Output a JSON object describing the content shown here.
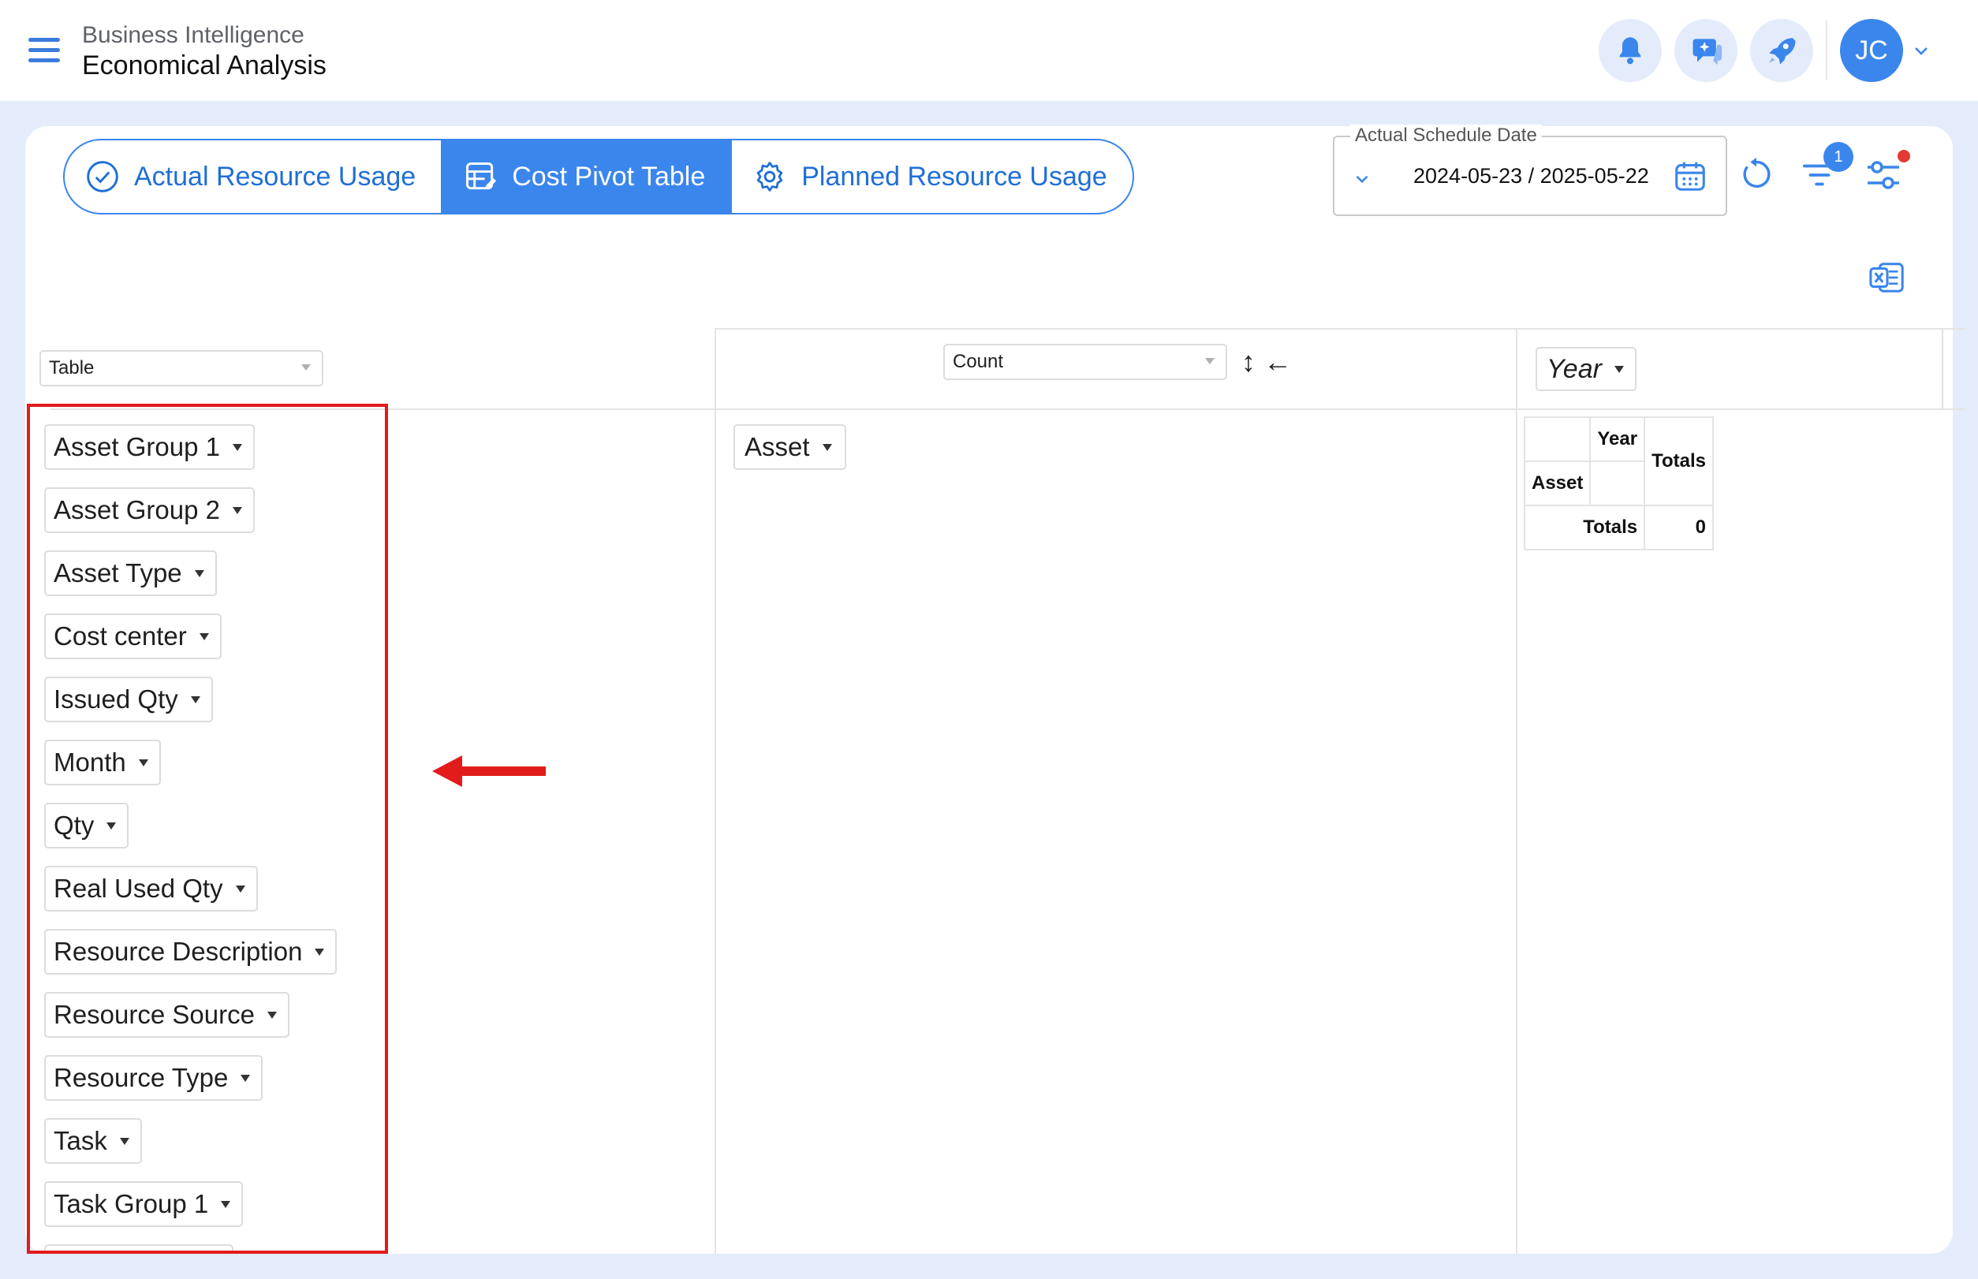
{
  "header": {
    "breadcrumb_parent": "Business Intelligence",
    "page_title": "Economical Analysis",
    "avatar_initials": "JC"
  },
  "tabs": [
    {
      "label": "Actual Resource Usage",
      "icon": "check-circle-icon",
      "active": false
    },
    {
      "label": "Cost Pivot Table",
      "icon": "table-edit-icon",
      "active": true
    },
    {
      "label": "Planned Resource Usage",
      "icon": "gear-icon",
      "active": false
    }
  ],
  "date_filter": {
    "label": "Actual Schedule Date",
    "value": "2024-05-23 / 2025-05-22"
  },
  "filter_badge_count": "1",
  "pivot": {
    "renderer_select": "Table",
    "aggregator_select": "Count",
    "sort_arrows": "↕ ←",
    "unused_fields": [
      "Asset Group 1",
      "Asset Group 2",
      "Asset Type",
      "Cost center",
      "Issued Qty",
      "Month",
      "Qty",
      "Real Used Qty",
      "Resource Description",
      "Resource Source",
      "Resource Type",
      "Task",
      "Task Group 1"
    ],
    "column_field": "Year",
    "row_field": "Asset",
    "table": {
      "col_header": "Year",
      "row_header": "Asset",
      "totals_header": "Totals",
      "totals_label": "Totals",
      "grand_total": "0"
    }
  },
  "colors": {
    "accent": "#3a86ec",
    "background": "#e4ecfb",
    "highlight": "#e21b1b"
  }
}
